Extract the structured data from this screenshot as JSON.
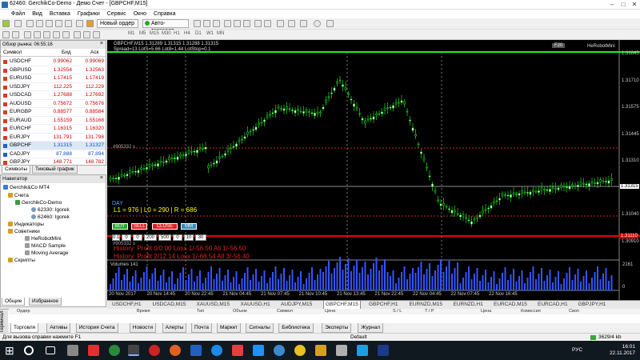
{
  "window": {
    "title": "62460: GerchikCo-Demo - Демо Счет - [GBPCHF,M15]"
  },
  "menu": [
    "Файл",
    "Вид",
    "Вставка",
    "Графики",
    "Сервис",
    "Окно",
    "Справка"
  ],
  "toolbar": {
    "new_order": "Новый ордер",
    "autotrade": "Авто-торговля",
    "timeframes": [
      "M1",
      "M5",
      "M15",
      "M30",
      "H1",
      "H4",
      "D1",
      "W1",
      "MN"
    ]
  },
  "market_watch": {
    "header": "Обзор рынка: 06:55:16",
    "col_symbol": "Символ",
    "col_bid": "Бид",
    "col_ask": "Аск",
    "rows": [
      {
        "symbol": "USDCHF",
        "bid": "0.99062",
        "ask": "0.99069",
        "dir": "down"
      },
      {
        "symbol": "GBPUSD",
        "bid": "1.32554",
        "ask": "1.32563",
        "dir": "down"
      },
      {
        "symbol": "EURUSD",
        "bid": "1.17415",
        "ask": "1.17419",
        "dir": "down"
      },
      {
        "symbol": "USDJPY",
        "bid": "112.225",
        "ask": "112.229",
        "dir": "down"
      },
      {
        "symbol": "USDCAD",
        "bid": "1.27688",
        "ask": "1.27692",
        "dir": "down"
      },
      {
        "symbol": "AUDUSD",
        "bid": "0.75672",
        "ask": "0.75676",
        "dir": "down"
      },
      {
        "symbol": "EURGBP",
        "bid": "0.88577",
        "ask": "0.88584",
        "dir": "down"
      },
      {
        "symbol": "EURAUD",
        "bid": "1.55159",
        "ask": "1.55168",
        "dir": "down"
      },
      {
        "symbol": "EURCHF",
        "bid": "1.16315",
        "ask": "1.16320",
        "dir": "down"
      },
      {
        "symbol": "EURJPY",
        "bid": "131.791",
        "ask": "131.798",
        "dir": "down"
      },
      {
        "symbol": "GBPCHF",
        "bid": "1.31315",
        "ask": "1.31327",
        "dir": "up"
      },
      {
        "symbol": "CADJPY",
        "bid": "87.888",
        "ask": "87.894",
        "dir": "up"
      },
      {
        "symbol": "GBPJPY",
        "bid": "148.771",
        "ask": "148.782",
        "dir": "down"
      }
    ],
    "tabs": [
      "Символы",
      "Тиковый график"
    ]
  },
  "navigator": {
    "header": "Навигатор",
    "root": "Gerchik&Co MT4",
    "accounts": "Счета",
    "server": "GerchikCo-Demo",
    "acc1": "62330: Igorek",
    "acc2": "62460: Igorek",
    "indicators": "Индикаторы",
    "advisors": "Советники",
    "ea1": "HeRobotMini",
    "ea2": "MACD Sample",
    "ea3": "Moving Average",
    "scripts": "Скрипты",
    "tabs": [
      "Общие",
      "Избранное"
    ]
  },
  "chart": {
    "header": "GBPCHF,M15  1.31289 1.31315 1.31288 1.31315",
    "header2": "Spread=13  LotS=5.66  Lot8=1.44  LotStop=0.1",
    "ea_label": "HeRobotMini",
    "ea_badge": "F20",
    "price_labels": [
      "1.31845",
      "1.31710",
      "1.31575",
      "1.31445",
      "1.31310",
      "1.31175",
      "1.31040",
      "1.30910"
    ],
    "current_price": "1.31315",
    "red_price": "1.31110",
    "level_label": "#905332 s",
    "level_label2": "#905332 s",
    "day_label": "DAY",
    "stats_label": "L1 = 976 | L0 = 290 | R = 686",
    "buttons": {
      "buy": "BUY",
      "sell": "SELL",
      "close": "CLOSE",
      "mm": "MM"
    },
    "params": [
      "0.1",
      "0",
      "0",
      "200",
      "500",
      "0",
      "10",
      "30"
    ],
    "history1": "History: Profit 0/0.00  Loss 1/-56.50  All 1/-56.50",
    "history2": "History: Profit 2/12.14  Loss 1/-68.54  All 3/-56.40",
    "vol_label": "Volumes 141",
    "vol_max": "2161",
    "vol_zero": "0",
    "time_labels": [
      "20 Nov 2017",
      "20 Nov 14:45",
      "20 Nov 22:45",
      "21 Nov 04:45",
      "21 Nov 07:45",
      "21 Nov 10:45",
      "21 Nov 13:45",
      "21 Nov 22:45",
      "22 Nov 04:45",
      "22 Nov 07:45",
      "22 Nov 16:45"
    ]
  },
  "chart_tabs": [
    "USDCHF,H1",
    "USDCAD,M15",
    "XAUUSD,M15",
    "XAUUSD,H1",
    "AUDJPY,M15",
    "GBPCHF,M15",
    "GBPCHF,H1",
    "EURNZD,M15",
    "EURNZD,H1",
    "EURCAD,M15",
    "EURCAD,H1",
    "GBPJPY,H1"
  ],
  "terminal": {
    "side_label": "Терминал",
    "columns": [
      "Ордер",
      "Время",
      "Тип",
      "Объем",
      "Символ",
      "Цена",
      "S / L",
      "T / P",
      "Цена",
      "Комиссия",
      "Своп"
    ],
    "tabs": [
      "Торговля",
      "Активы",
      "История Счета",
      "Новости",
      "Алерты",
      "Почта",
      "Маркет",
      "Сигналы",
      "Библиотека",
      "Эксперты",
      "Журнал"
    ],
    "market_badge": "15",
    "mail_badge": "1"
  },
  "status": {
    "help": "Для вызова справки нажмите F1",
    "profile": "Default",
    "traffic": "3629/4 kb"
  },
  "tray": {
    "time": "16:01",
    "date": "22.11.2017",
    "lang": "РУС"
  }
}
